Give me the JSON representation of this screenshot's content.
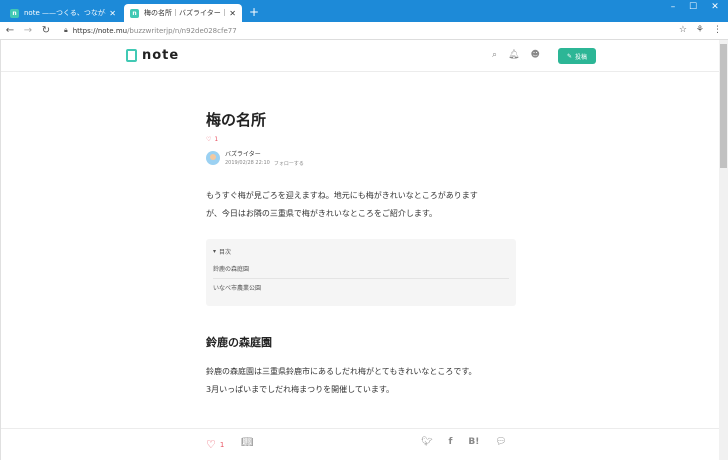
{
  "browser": {
    "tabs": [
      {
        "title": "note ——つくる、つながる、とどける。",
        "active": false
      },
      {
        "title": "梅の名所｜バズライター｜note",
        "active": true
      }
    ],
    "new_tab_symbol": "+",
    "window_controls": [
      "–",
      "☐",
      "✕"
    ],
    "url_host": "https://note.mu",
    "url_path": "/buzzwriterjp/n/n92de028cfe77"
  },
  "site": {
    "logo_text": "note",
    "post_button_label": "投稿"
  },
  "article": {
    "title": "梅の名所",
    "like_count": "1",
    "author_name": "バズライター",
    "date": "2019/02/28 22:10",
    "follow_label": "フォローする",
    "lead_line1": "もうすぐ梅が見ごろを迎えますね。地元にも梅がきれいなところがあります",
    "lead_line2": "が、今日はお隣の三重県で梅がきれいなところをご紹介します。",
    "toc_heading": "目次",
    "toc_items": [
      "鈴鹿の森庭園",
      "いなべ市農業公園"
    ],
    "section_heading": "鈴鹿の森庭園",
    "section_line1": "鈴鹿の森庭園は三重県鈴鹿市にあるしだれ梅がとてもきれいなところです。",
    "section_line2": "3月いっぱいまでしだれ梅まつりを開催しています。"
  },
  "bottom_bar": {
    "like_count": "1",
    "share_label_hatena": "B!"
  },
  "colors": {
    "browser_tab_strip": "#1d8ad8",
    "note_accent": "#2cb696",
    "like_red": "#e95464"
  }
}
